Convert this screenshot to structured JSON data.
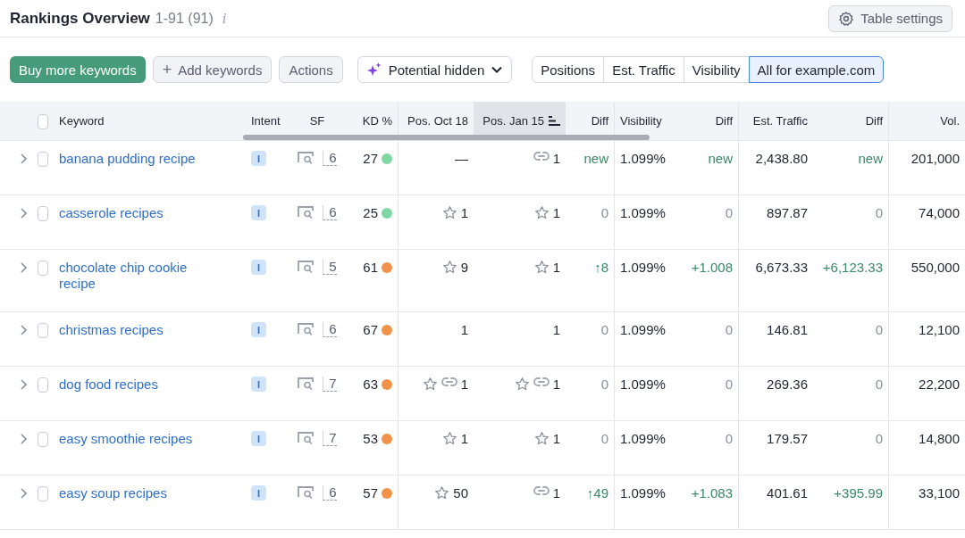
{
  "header": {
    "title": "Rankings Overview",
    "count": "1-91 (91)",
    "info": "i",
    "settings_button": "Table settings"
  },
  "toolbar": {
    "buy_button": "Buy more keywords",
    "add_button": "Add keywords",
    "add_icon": "+",
    "actions_button": "Actions",
    "potential_dropdown": "Potential hidden",
    "views": [
      {
        "label": "Positions",
        "selected": false
      },
      {
        "label": "Est. Traffic",
        "selected": false
      },
      {
        "label": "Visibility",
        "selected": false
      },
      {
        "label": "All for example.com",
        "selected": true
      }
    ]
  },
  "table": {
    "all_checked": false,
    "columns": [
      {
        "label": "Keyword",
        "sorted": false
      },
      {
        "label": "Intent",
        "sorted": false
      },
      {
        "label": "SF",
        "sorted": false
      },
      {
        "label": "KD %",
        "sorted": false
      },
      {
        "label": "Pos. Oct 18",
        "sorted": false
      },
      {
        "label": "Pos. Jan 15",
        "sorted": true
      },
      {
        "label": "Diff",
        "sorted": false
      },
      {
        "label": "Visibility",
        "sorted": false
      },
      {
        "label": "Diff",
        "sorted": false
      },
      {
        "label": "Est. Traffic",
        "sorted": false
      },
      {
        "label": "Diff",
        "sorted": false
      },
      {
        "label": "Vol.",
        "sorted": false
      }
    ],
    "rows": [
      {
        "keyword": "banana pudding recipe",
        "checked": false,
        "intent": "I",
        "sf": "6",
        "kd": {
          "text": "27",
          "color": "#7fd8a4"
        },
        "pos_oct": {
          "text": "—",
          "star": false,
          "link": false
        },
        "pos_jan": {
          "text": "1",
          "star": false,
          "link": true
        },
        "diff": {
          "text": "new",
          "gain": true
        },
        "visibility": "1.099%",
        "vis_diff": {
          "text": "new",
          "gain": true
        },
        "traffic": "2,438.80",
        "traffic_diff": {
          "text": "new",
          "gain": true
        },
        "volume": "201,000"
      },
      {
        "keyword": "casserole recipes",
        "checked": false,
        "intent": "I",
        "sf": "6",
        "kd": {
          "text": "25",
          "color": "#7fd8a4"
        },
        "pos_oct": {
          "text": "1",
          "star": true,
          "link": false
        },
        "pos_jan": {
          "text": "1",
          "star": true,
          "link": false
        },
        "diff": {
          "text": "0",
          "gain": false
        },
        "visibility": "1.099%",
        "vis_diff": {
          "text": "0",
          "gain": false
        },
        "traffic": "897.87",
        "traffic_diff": {
          "text": "0",
          "gain": false
        },
        "volume": "74,000"
      },
      {
        "keyword": "chocolate chip cookie recipe",
        "checked": false,
        "intent": "I",
        "sf": "5",
        "kd": {
          "text": "61",
          "color": "#f0924a"
        },
        "pos_oct": {
          "text": "9",
          "star": true,
          "link": false
        },
        "pos_jan": {
          "text": "1",
          "star": true,
          "link": false
        },
        "diff": {
          "text": "↑8",
          "gain": true
        },
        "visibility": "1.099%",
        "vis_diff": {
          "text": "+1.008",
          "gain": true
        },
        "traffic": "6,673.33",
        "traffic_diff": {
          "text": "+6,123.33",
          "gain": true
        },
        "volume": "550,000"
      },
      {
        "keyword": "christmas recipes",
        "checked": false,
        "intent": "I",
        "sf": "6",
        "kd": {
          "text": "67",
          "color": "#f0924a"
        },
        "pos_oct": {
          "text": "1",
          "star": false,
          "link": false
        },
        "pos_jan": {
          "text": "1",
          "star": false,
          "link": false
        },
        "diff": {
          "text": "0",
          "gain": false
        },
        "visibility": "1.099%",
        "vis_diff": {
          "text": "0",
          "gain": false
        },
        "traffic": "146.81",
        "traffic_diff": {
          "text": "0",
          "gain": false
        },
        "volume": "12,100"
      },
      {
        "keyword": "dog food recipes",
        "checked": false,
        "intent": "I",
        "sf": "7",
        "kd": {
          "text": "63",
          "color": "#f0924a"
        },
        "pos_oct": {
          "text": "1",
          "star": true,
          "link": true
        },
        "pos_jan": {
          "text": "1",
          "star": true,
          "link": true
        },
        "diff": {
          "text": "0",
          "gain": false
        },
        "visibility": "1.099%",
        "vis_diff": {
          "text": "0",
          "gain": false
        },
        "traffic": "269.36",
        "traffic_diff": {
          "text": "0",
          "gain": false
        },
        "volume": "22,200"
      },
      {
        "keyword": "easy smoothie recipes",
        "checked": false,
        "intent": "I",
        "sf": "7",
        "kd": {
          "text": "53",
          "color": "#f0924a"
        },
        "pos_oct": {
          "text": "1",
          "star": true,
          "link": false
        },
        "pos_jan": {
          "text": "1",
          "star": true,
          "link": false
        },
        "diff": {
          "text": "0",
          "gain": false
        },
        "visibility": "1.099%",
        "vis_diff": {
          "text": "0",
          "gain": false
        },
        "traffic": "179.57",
        "traffic_diff": {
          "text": "0",
          "gain": false
        },
        "volume": "14,800"
      },
      {
        "keyword": "easy soup recipes",
        "checked": false,
        "intent": "I",
        "sf": "6",
        "kd": {
          "text": "57",
          "color": "#f0924a"
        },
        "pos_oct": {
          "text": "50",
          "star": true,
          "link": false
        },
        "pos_jan": {
          "text": "1",
          "star": false,
          "link": true
        },
        "diff": {
          "text": "↑49",
          "gain": true
        },
        "visibility": "1.099%",
        "vis_diff": {
          "text": "+1.083",
          "gain": true
        },
        "traffic": "401.61",
        "traffic_diff": {
          "text": "+395.99",
          "gain": true
        },
        "volume": "33,100"
      }
    ]
  }
}
